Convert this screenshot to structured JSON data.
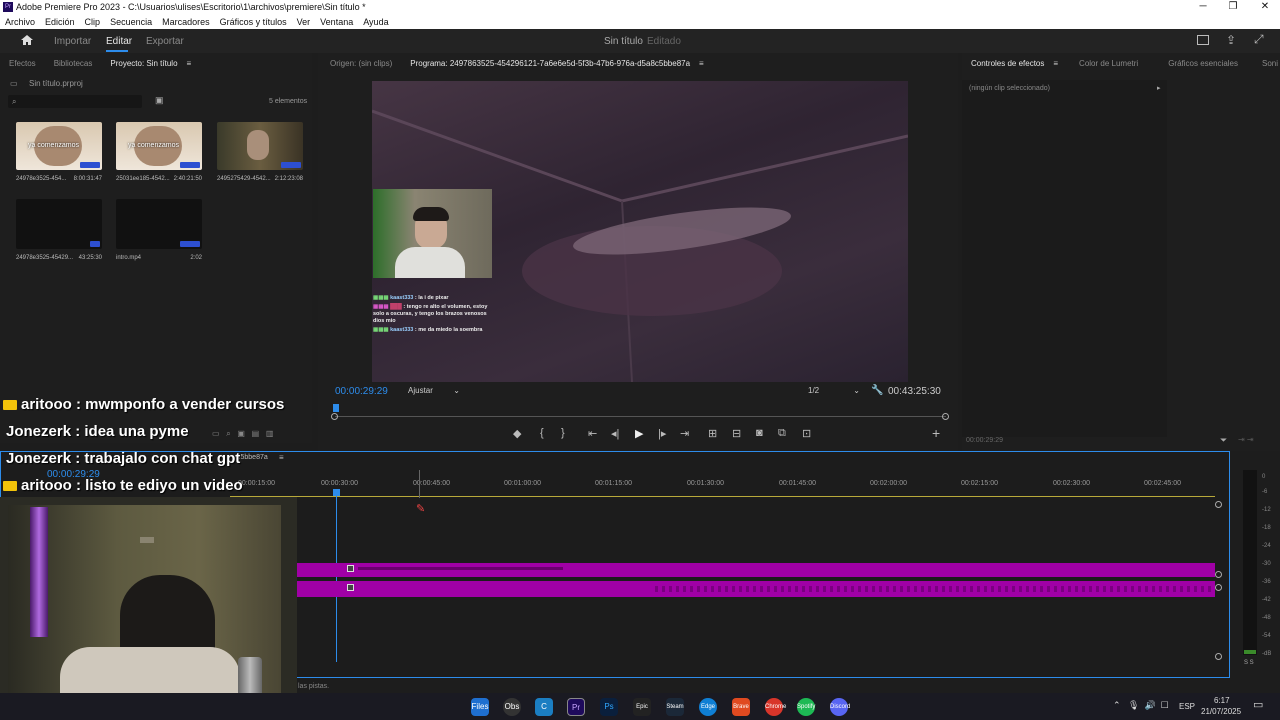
{
  "window": {
    "title": "Adobe Premiere Pro 2023 - C:\\Usuarios\\ulises\\Escritorio\\1\\archivos\\premiere\\Sin título *",
    "app_icon": "Pr"
  },
  "menu": [
    "Archivo",
    "Edición",
    "Clip",
    "Secuencia",
    "Marcadores",
    "Gráficos y títulos",
    "Ver",
    "Ventana",
    "Ayuda"
  ],
  "workspace": {
    "tabs": [
      "Importar",
      "Editar",
      "Exportar"
    ],
    "active": "Editar",
    "project_title": "Sin título",
    "project_status": "Editado"
  },
  "project_panel": {
    "tabs": [
      "Efectos",
      "Bibliotecas",
      "Proyecto: Sin título"
    ],
    "file": "Sin título.prproj",
    "count": "5 elementos",
    "items": [
      {
        "name": "24978e3525-454...",
        "duration": "8:00:31:47",
        "overlay_text": "ya comenzamos"
      },
      {
        "name": "25031ee185-4542...",
        "duration": "2:40:21:50",
        "overlay_text": "ya comenzamos"
      },
      {
        "name": "2495275429-4542...",
        "duration": "2:12:23:08",
        "overlay_text": ""
      },
      {
        "name": "24978e3525-45429...",
        "duration": "43:25:30",
        "overlay_text": ""
      },
      {
        "name": "intro.mp4",
        "duration": "2:02",
        "overlay_text": ""
      }
    ]
  },
  "program_monitor": {
    "tabs": [
      "Origen: (sin clips)",
      "Programa: 2497863525-454296121-7a6e6e5d-5f3b-47b6-976a-d5a8c5bbe87a"
    ],
    "timecode": "00:00:29:29",
    "fit": "Ajustar",
    "resolution": "1/2",
    "duration": "00:43:25:30",
    "chat": [
      {
        "user": "kaast333",
        "msg": "la i de pixar"
      },
      {
        "user": "",
        "msg": "tengo re alto el volumen, estoy solo a oscuras, y tengo los brazos venosos dios mio"
      },
      {
        "user": "kaast333",
        "msg": "me da miedo la soembra"
      }
    ]
  },
  "effects_panel": {
    "tabs": [
      "Controles de efectos",
      "Color de Lumetri",
      "Gráficos esenciales",
      "Soni"
    ],
    "empty": "(ningún clip seleccionado)",
    "timecode": "00:00:29:29"
  },
  "timeline": {
    "sequence_name": "c5bbe87a",
    "timecode": "00:00:29:29",
    "ruler": [
      "00:00:15:00",
      "00:00:30:00",
      "00:00:45:00",
      "00:01:00:00",
      "00:01:15:00",
      "00:01:30:00",
      "00:01:45:00",
      "00:02:00:00",
      "00:02:15:00",
      "00:02:30:00",
      "00:02:45:00"
    ],
    "status": "las pistas.",
    "playhead_fraction": 0.17
  },
  "meter": {
    "scale": [
      "0",
      "-6",
      "-12",
      "-18",
      "-24",
      "-30",
      "-36",
      "-42",
      "-48",
      "-54",
      "-dB"
    ],
    "solo": "S S"
  },
  "overlay_chat": [
    {
      "user": "aritooo",
      "msg": ": mwmponfo a vender cursos",
      "badge": true
    },
    {
      "user": "Jonezerk",
      "msg": ": idea una pyme",
      "badge": false
    },
    {
      "user": "Jonezerk",
      "msg": ": trabajalo con chat gpt",
      "badge": false
    },
    {
      "user": "aritooo",
      "msg": ": listo te ediyo un video",
      "badge": true
    }
  ],
  "taskbar": {
    "apps": [
      "Files",
      "Obs",
      "C",
      "Pr",
      "Ps",
      "Epic",
      "Steam",
      "Edge",
      "Brave",
      "Chrome",
      "Spotify",
      "Discord"
    ],
    "lang": "ESP",
    "time": "6:17",
    "date": "21/07/2025"
  },
  "colors": {
    "accent": "#2d8ceb",
    "clip": "#a000a6",
    "timecode": "#2d8ceb"
  }
}
